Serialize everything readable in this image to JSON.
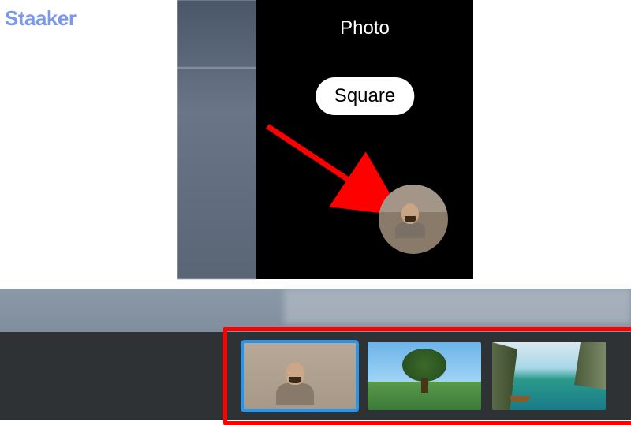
{
  "watermark": "Staaker",
  "camera": {
    "mode_label": "Photo",
    "aspect_button": "Square"
  },
  "thumbnails": [
    {
      "name": "gallery-thumb-selfie",
      "selected": true
    },
    {
      "name": "gallery-thumb-tree",
      "selected": false
    },
    {
      "name": "gallery-thumb-lake",
      "selected": false
    }
  ],
  "colors": {
    "highlight_red": "#ff0000",
    "selection_blue": "#2196f3"
  }
}
